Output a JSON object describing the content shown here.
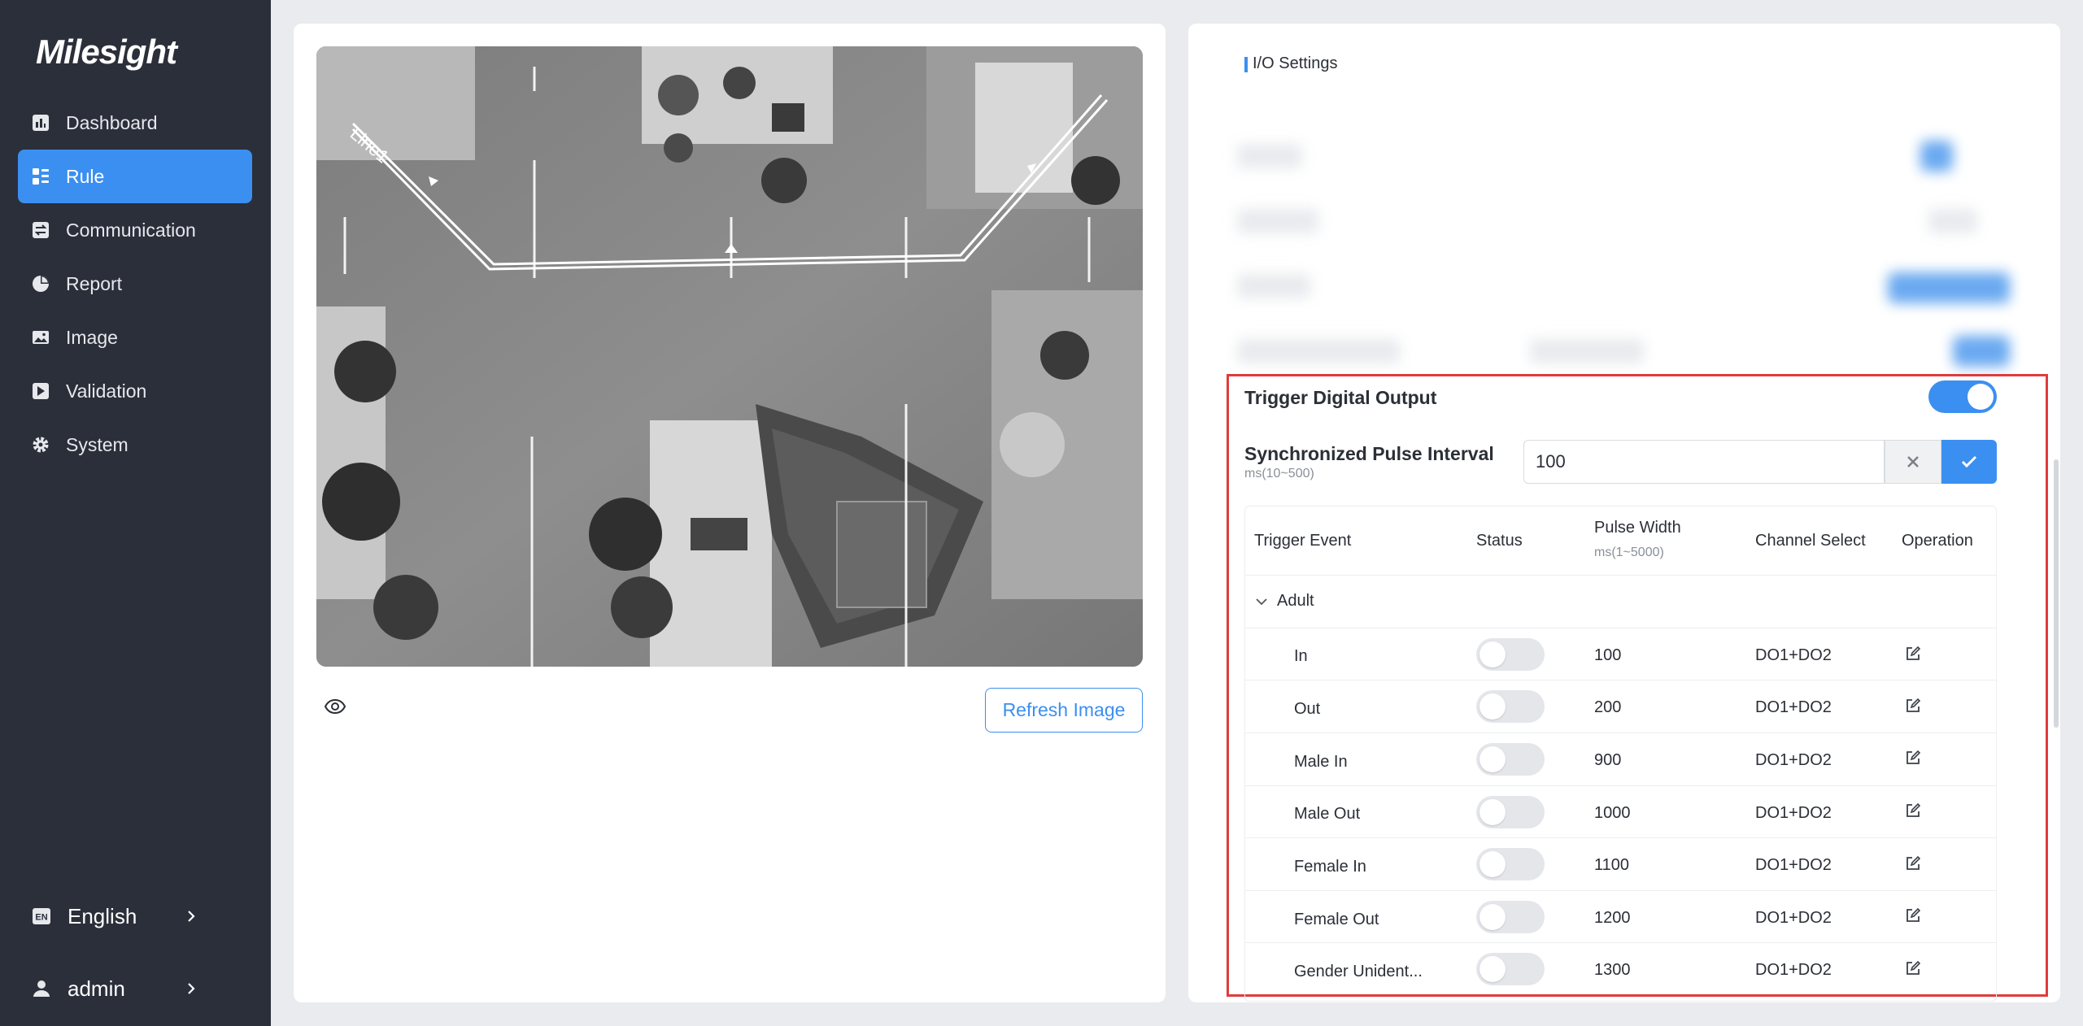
{
  "brand": {
    "logo_text": "Milesight",
    "accent": "#3b8ff0"
  },
  "sidebar": {
    "items": [
      {
        "label": "Dashboard",
        "icon": "bar-chart-icon",
        "active": false
      },
      {
        "label": "Rule",
        "icon": "rule-grid-icon",
        "active": true
      },
      {
        "label": "Communication",
        "icon": "communication-icon",
        "active": false
      },
      {
        "label": "Report",
        "icon": "pie-chart-icon",
        "active": false
      },
      {
        "label": "Image",
        "icon": "image-icon",
        "active": false
      },
      {
        "label": "Validation",
        "icon": "validation-icon",
        "active": false
      },
      {
        "label": "System",
        "icon": "gear-icon",
        "active": false
      }
    ],
    "language": {
      "badge": "EN",
      "label": "English"
    },
    "user": {
      "label": "admin"
    }
  },
  "preview": {
    "line_label": "Line1",
    "refresh_label": "Refresh Image"
  },
  "settings": {
    "section_title": "I/O Settings",
    "trigger_digital_output": {
      "label": "Trigger Digital Output",
      "enabled": true
    },
    "pulse_interval": {
      "label": "Synchronized Pulse Interval",
      "hint": "ms(10~500)",
      "value": "100"
    },
    "table": {
      "headers": {
        "trigger_event": "Trigger Event",
        "status": "Status",
        "pulse_width": "Pulse Width",
        "pulse_width_hint": "ms(1~5000)",
        "channel_select": "Channel Select",
        "operation": "Operation"
      },
      "group": "Adult",
      "rows": [
        {
          "event": "In",
          "status": false,
          "pulse_width": "100",
          "channel": "DO1+DO2"
        },
        {
          "event": "Out",
          "status": false,
          "pulse_width": "200",
          "channel": "DO1+DO2"
        },
        {
          "event": "Male In",
          "status": false,
          "pulse_width": "900",
          "channel": "DO1+DO2"
        },
        {
          "event": "Male Out",
          "status": false,
          "pulse_width": "1000",
          "channel": "DO1+DO2"
        },
        {
          "event": "Female In",
          "status": false,
          "pulse_width": "1100",
          "channel": "DO1+DO2"
        },
        {
          "event": "Female Out",
          "status": false,
          "pulse_width": "1200",
          "channel": "DO1+DO2"
        },
        {
          "event": "Gender Unident...",
          "status": false,
          "pulse_width": "1300",
          "channel": "DO1+DO2"
        }
      ]
    }
  }
}
